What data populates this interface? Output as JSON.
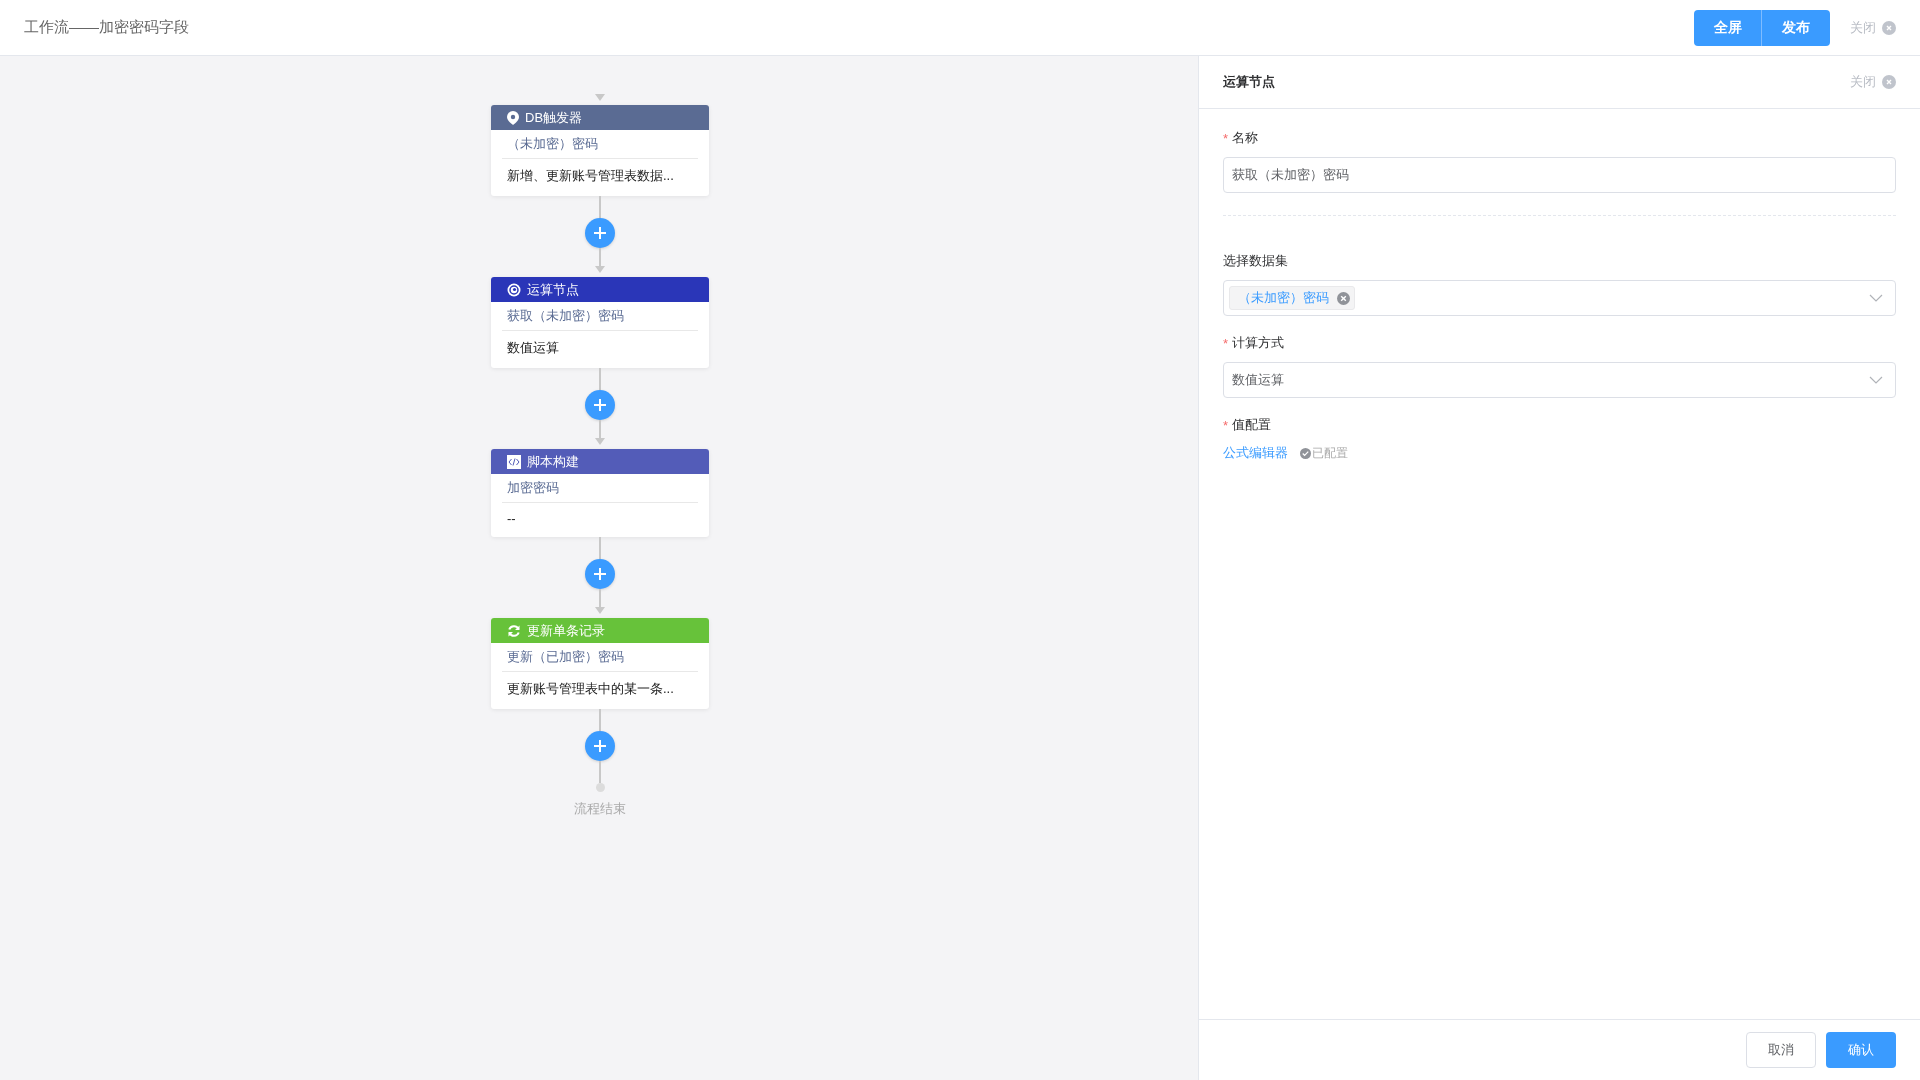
{
  "header": {
    "title": "工作流——加密密码字段",
    "buttons": [
      "全屏",
      "发布"
    ],
    "close_label": "关闭"
  },
  "flow": {
    "nodes": [
      {
        "kind": "trigger",
        "color": "#5a6b93",
        "title": "DB触发器",
        "name": "（未加密）密码",
        "description": "新增、更新账号管理表数据..."
      },
      {
        "kind": "compute",
        "color": "#2a36b8",
        "title": "运算节点",
        "name": "获取（未加密）密码",
        "description": "数值运算"
      },
      {
        "kind": "script",
        "color": "#535cb8",
        "title": "脚本构建",
        "name": "加密密码",
        "description": "--"
      },
      {
        "kind": "update",
        "color": "#67c23a",
        "title": "更新单条记录",
        "name": "更新（已加密）密码",
        "description": "更新账号管理表中的某一条..."
      }
    ],
    "end_label": "流程结束"
  },
  "panel": {
    "title": "运算节点",
    "close_label": "关闭",
    "name_field": {
      "label": "名称",
      "required_mark": "*",
      "value": "获取（未加密）密码"
    },
    "dataset_field": {
      "label": "选择数据集",
      "tags": [
        "（未加密）密码"
      ]
    },
    "method_field": {
      "label": "计算方式",
      "required_mark": "*",
      "value": "数值运算"
    },
    "value_config": {
      "label": "值配置",
      "required_mark": "*",
      "link": "公式编辑器",
      "status": "已配置",
      "configured": true
    },
    "buttons": [
      {
        "label": "取消",
        "kind": "secondary"
      },
      {
        "label": "确认",
        "kind": "primary"
      }
    ]
  }
}
